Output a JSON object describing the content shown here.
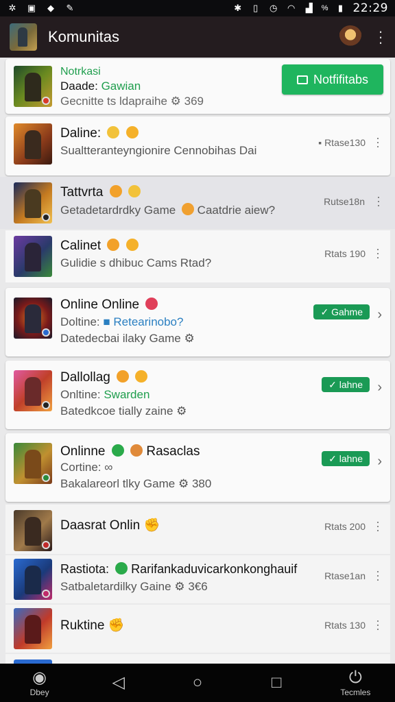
{
  "status_bar": {
    "time": "22:29",
    "battery": "%"
  },
  "app_bar": {
    "title": "Komunitas"
  },
  "notification_card": {
    "line1": "Notrkasi",
    "line2_prefix": "Daade:",
    "line2_accent": "Gawian",
    "line3": "Gecnitte ts ldapraihe",
    "line3_count": "369",
    "button_label": "Notfifitabs"
  },
  "items": [
    {
      "title": "Daline:",
      "sub": "Sualtteranteyngionire Cennobihas Dai",
      "meta": "Rtase130"
    },
    {
      "title": "Tattvrta",
      "sub": "Getadetardrdky Game",
      "sub2": "Caatdrie aiew?",
      "meta": "Rutse18n"
    },
    {
      "title": "Calinet",
      "sub": "Gulidie s dhibuc Cams Rtad?",
      "meta": "Rtats 190"
    },
    {
      "title": "Online Online",
      "sub_prefix": "Doltine:",
      "sub_accent": "Retearinobo?",
      "sub2": "Datedecbai ilaky Game",
      "pill": "Gahme"
    },
    {
      "title": "Dallollag",
      "sub_prefix": "Onltine:",
      "sub_accent": "Swarden",
      "sub2": "Batedkcoe tially zaine",
      "pill": "lahne"
    },
    {
      "title": "Onlinne",
      "title_suffix": "Rasaclas",
      "sub_prefix": "Cortine:",
      "sub2": "Bakalareorl tlky Game",
      "sub2_count": "380",
      "pill": "lahne"
    },
    {
      "title": "Daasrat Onlin",
      "meta": "Rtats 200"
    },
    {
      "title": "Rastiota:",
      "title_suffix": "Rarifankaduvicarkonkonghauif",
      "sub": "Satbaletardilky Gaine",
      "sub_count": "3€6",
      "meta": "Rtase1an"
    },
    {
      "title": "Ruktine",
      "meta": "Rtats 130"
    }
  ],
  "nav": {
    "left_label": "Dbey",
    "right_label": "Tecmles"
  }
}
